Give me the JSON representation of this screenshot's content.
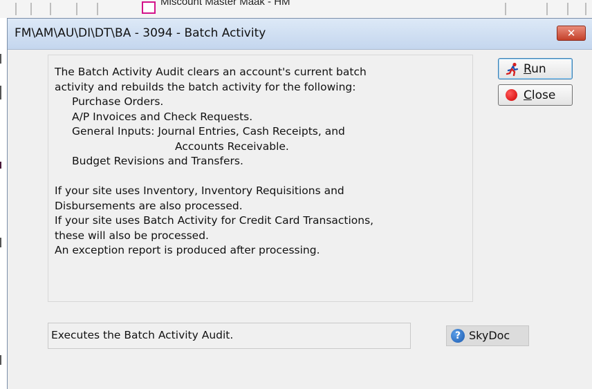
{
  "background": {
    "window_title_partial": "Miscount Master Maak - HM"
  },
  "dialog": {
    "title": "FM\\AM\\AU\\DI\\DT\\BA - 3094 - Batch Activity",
    "close_glyph": "✕",
    "description_lines": [
      {
        "text": "The Batch Activity Audit clears an account's current batch",
        "indent": 0
      },
      {
        "text": "activity and rebuilds the batch activity for the following:",
        "indent": 0
      },
      {
        "text": "Purchase Orders.",
        "indent": 1
      },
      {
        "text": "A/P Invoices and Check Requests.",
        "indent": 1
      },
      {
        "text": "General Inputs: Journal Entries, Cash Receipts, and",
        "indent": 1
      },
      {
        "text": "Accounts Receivable.",
        "indent": 2
      },
      {
        "text": "Budget Revisions and Transfers.",
        "indent": 1
      },
      {
        "text": "",
        "indent": 0
      },
      {
        "text": "If your site uses Inventory, Inventory Requisitions and",
        "indent": 0
      },
      {
        "text": "Disbursements are also processed.",
        "indent": 0
      },
      {
        "text": "If your site uses Batch Activity for Credit Card Transactions,",
        "indent": 0
      },
      {
        "text": "these will also be processed.",
        "indent": 0
      },
      {
        "text": "An exception report is produced after processing.",
        "indent": 0
      }
    ],
    "run_button": {
      "mnemonic": "R",
      "rest": "un",
      "icon": "runner-icon"
    },
    "close_button": {
      "mnemonic": "C",
      "rest": "lose",
      "icon": "red-dot-icon"
    },
    "status_text": "Executes the Batch Activity Audit.",
    "skydoc": {
      "label": "SkyDoc",
      "icon": "help-question-icon"
    }
  },
  "colors": {
    "titlebar": "#c4d6ee",
    "close_x": "#c4402a",
    "dialog_bg": "#f0f0f0",
    "run_focus": "#3c7fb1"
  }
}
